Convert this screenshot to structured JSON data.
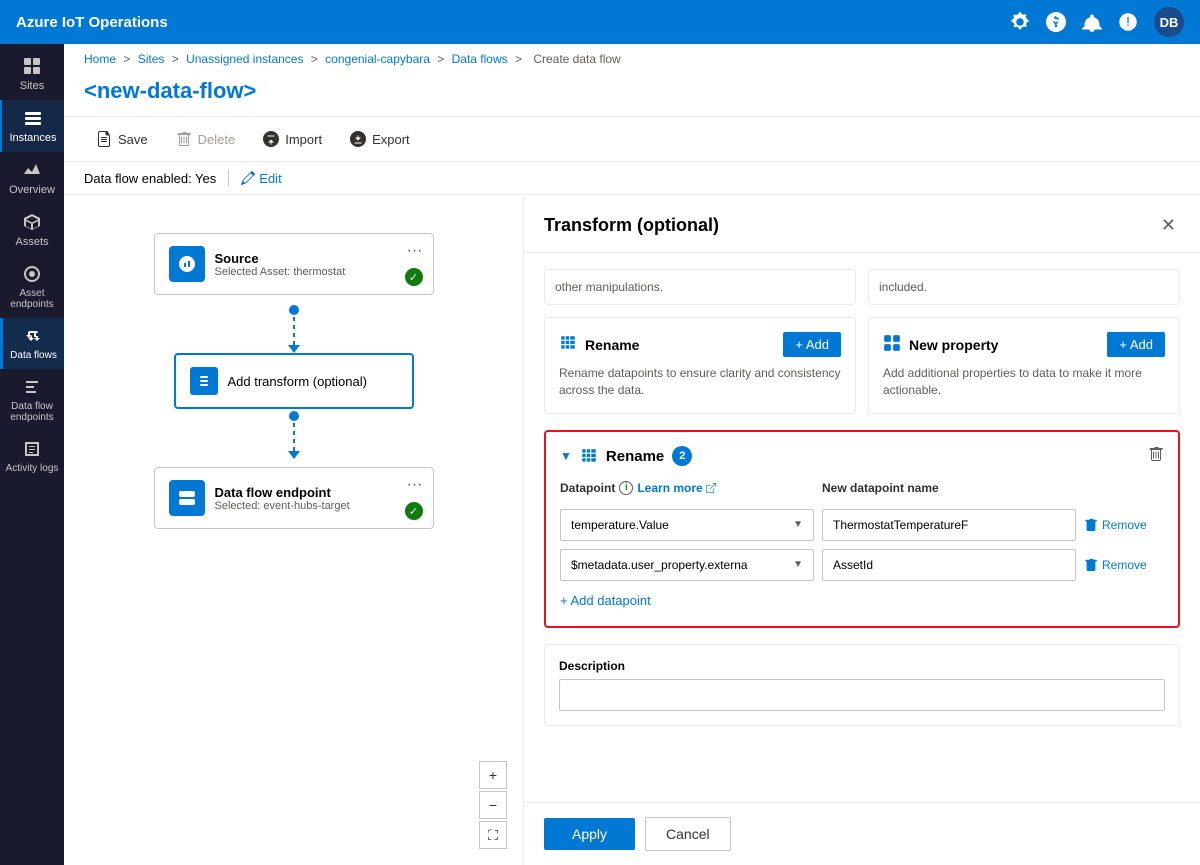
{
  "app": {
    "title": "Azure IoT Operations",
    "user_initials": "DB"
  },
  "sidebar": {
    "items": [
      {
        "id": "sites",
        "label": "Sites",
        "icon": "grid"
      },
      {
        "id": "instances",
        "label": "Instances",
        "icon": "server",
        "active": true
      },
      {
        "id": "overview",
        "label": "Overview",
        "icon": "chart"
      },
      {
        "id": "assets",
        "label": "Assets",
        "icon": "box"
      },
      {
        "id": "asset-endpoints",
        "label": "Asset endpoints",
        "icon": "plug"
      },
      {
        "id": "dataflows",
        "label": "Data flows",
        "icon": "flow",
        "selected": true
      },
      {
        "id": "dataflow-endpoints",
        "label": "Data flow endpoints",
        "icon": "endpoint"
      },
      {
        "id": "activity-logs",
        "label": "Activity logs",
        "icon": "log"
      }
    ]
  },
  "breadcrumb": {
    "items": [
      "Home",
      "Sites",
      "Unassigned instances",
      "congenial-capybara",
      "Data flows",
      "Create data flow"
    ],
    "separator": ">"
  },
  "page": {
    "title": "<new-data-flow>"
  },
  "toolbar": {
    "save_label": "Save",
    "delete_label": "Delete",
    "import_label": "Import",
    "export_label": "Export"
  },
  "status": {
    "enabled_label": "Data flow enabled: Yes",
    "edit_label": "Edit"
  },
  "canvas": {
    "source_node": {
      "title": "Source",
      "subtitle": "Selected Asset: thermostat"
    },
    "transform_node": {
      "title": "Add transform (optional)"
    },
    "endpoint_node": {
      "title": "Data flow endpoint",
      "subtitle": "Selected: event-hubs-target"
    },
    "controls": {
      "zoom_in": "+",
      "zoom_out": "−",
      "reset": "⛶"
    }
  },
  "transform_panel": {
    "title": "Transform (optional)",
    "partial_text_left": "other manipulations.",
    "partial_text_right": "included.",
    "rename_card": {
      "title": "Rename",
      "description": "Rename datapoints to ensure clarity and consistency across the data.",
      "add_label": "+ Add"
    },
    "new_property_card": {
      "title": "New property",
      "description": "Add additional properties to data to make it more actionable.",
      "add_label": "+ Add"
    },
    "rename_section": {
      "title": "Rename",
      "badge": "2",
      "datapoint_label": "Datapoint",
      "learn_more_label": "Learn more",
      "new_name_label": "New datapoint name",
      "rows": [
        {
          "datapoint_value": "temperature.Value",
          "new_name_value": "ThermostatTemperatureF"
        },
        {
          "datapoint_value": "$metadata.user_property.externa",
          "new_name_value": "AssetId"
        }
      ],
      "remove_label": "Remove",
      "add_datapoint_label": "+ Add datapoint"
    },
    "description_section": {
      "label": "Description"
    },
    "actions": {
      "apply_label": "Apply",
      "cancel_label": "Cancel"
    }
  }
}
